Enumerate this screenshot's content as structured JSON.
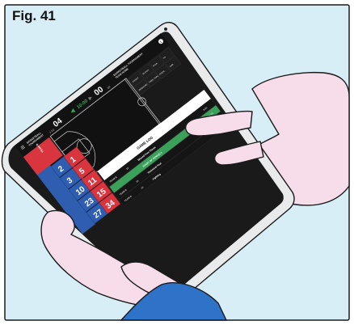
{
  "figure": {
    "label": "Fig. 41",
    "background_color": "#d8eef6",
    "frame_color": "#1a1a1a"
  },
  "tablet": {
    "bezel_color": "#e9eaec",
    "screen_color": "#1a1a1a",
    "header": {
      "menu_icon": "hamburger-icon",
      "game_title": "BASKETBALL\nTOURNAMENT",
      "team_a_score": "04",
      "team_a_sub": "2 1/2",
      "clock": "10:00",
      "team_b_score": "00",
      "team_b_sub": "1/2",
      "top_title": "BASKETBALL TOURNAMENT\nTEAM HOME",
      "period": "1"
    },
    "actions": [
      {
        "label": "ASSIST"
      },
      {
        "label": "REBOUND"
      },
      {
        "label": "BLOCK"
      },
      {
        "label": "FREE THROW"
      },
      {
        "label": "FOUL"
      },
      {
        "label": "STEAL"
      },
      {
        "label": "TO"
      },
      {
        "label": "SUB"
      }
    ],
    "team_a": {
      "name": "TEAM A",
      "color": "#2f5db0",
      "players": [
        "2",
        "3",
        "10",
        "23",
        "27"
      ]
    },
    "team_b": {
      "name": "TEAM B",
      "color": "#d9353f",
      "players": [
        "1",
        "5",
        "11",
        "15",
        "34"
      ]
    },
    "game_log": {
      "title": "GAME LOG",
      "accent_color": "#3aa05a",
      "rows": [
        {
          "team": "TEAM B",
          "number": "10",
          "text": "Missed Free Throw",
          "time": "9:51"
        },
        {
          "team": "",
          "number": "",
          "text": "START OF PERIOD 1",
          "time": "10:00"
        },
        {
          "team": "TEAM B",
          "number": "15",
          "text": "Technical Foul",
          "time": "9:51"
        },
        {
          "team": "TEAM B",
          "number": "10",
          "text": "Fighting",
          "time": "9:51"
        }
      ]
    }
  },
  "hands": {
    "skin_color": "#f7dcea",
    "outline_color": "#1a1a1a",
    "sleeve_color": "#2f73c8"
  }
}
